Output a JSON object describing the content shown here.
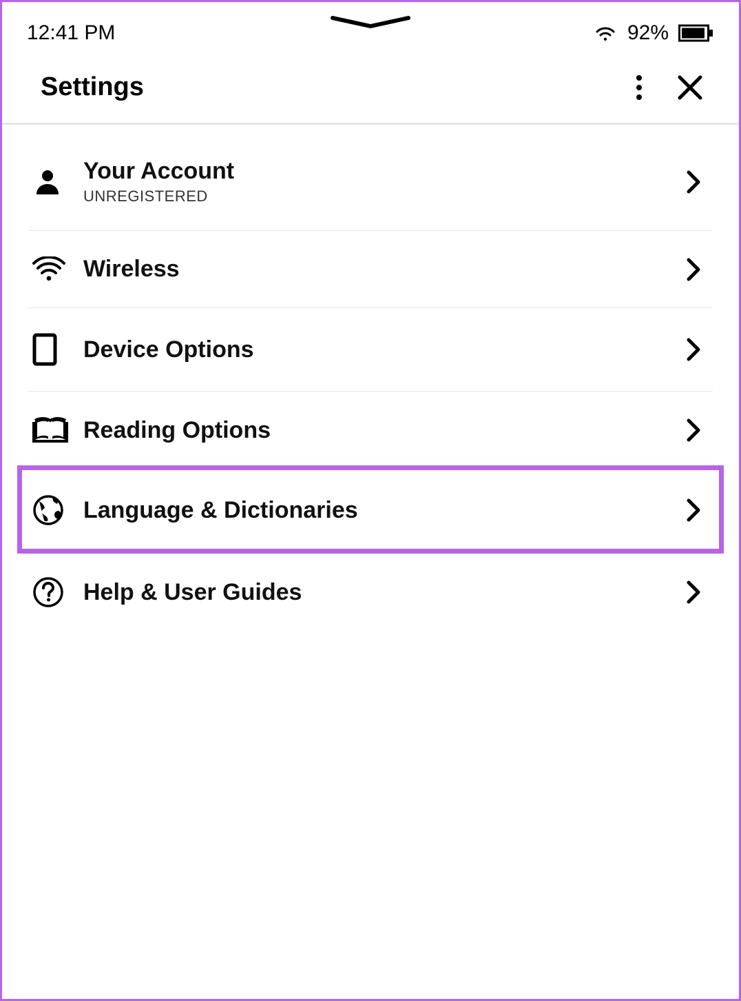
{
  "statusBar": {
    "time": "12:41 PM",
    "batteryPercent": "92%"
  },
  "header": {
    "title": "Settings"
  },
  "items": [
    {
      "title": "Your Account",
      "subtitle": "UNREGISTERED"
    },
    {
      "title": "Wireless"
    },
    {
      "title": "Device Options"
    },
    {
      "title": "Reading Options"
    },
    {
      "title": "Language & Dictionaries"
    },
    {
      "title": "Help & User Guides"
    }
  ]
}
